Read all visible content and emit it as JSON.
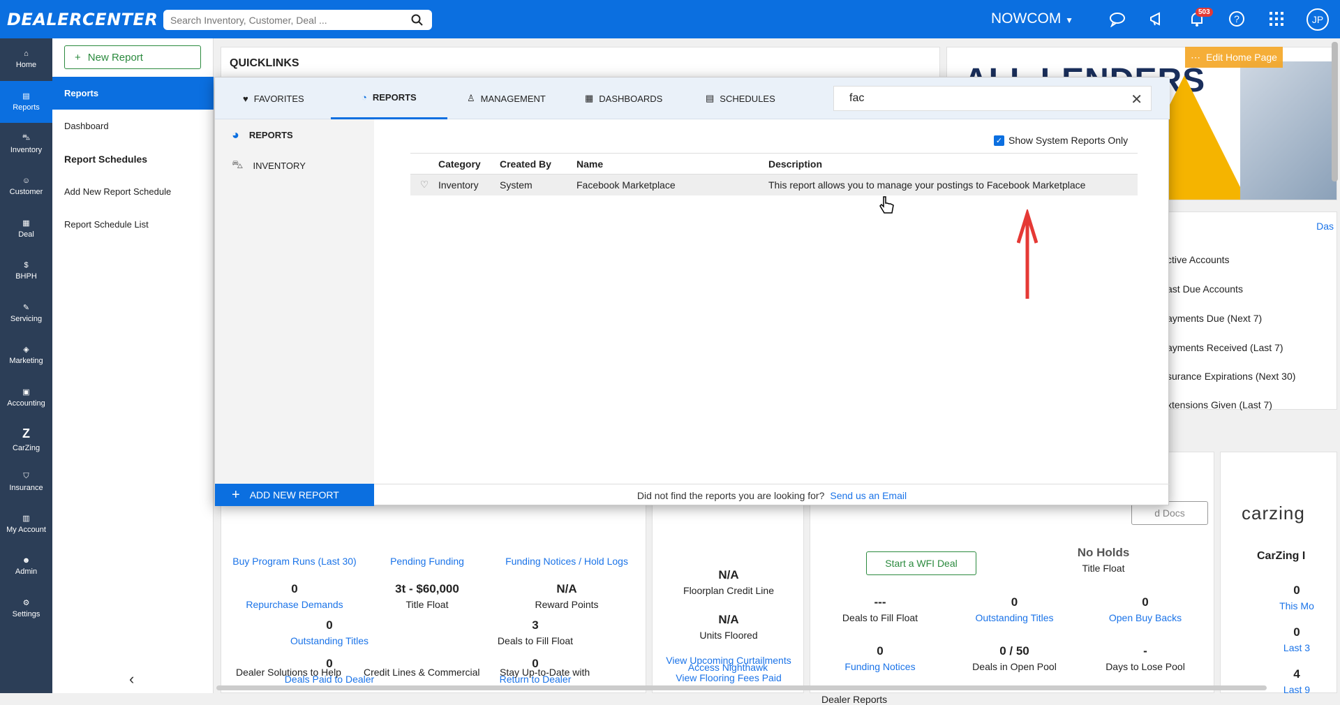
{
  "topbar": {
    "logo": "DEALERCENTER",
    "search_placeholder": "Search Inventory, Customer, Deal ...",
    "company": "NOWCOM",
    "notification_count": "503",
    "avatar": "JP"
  },
  "nav": [
    {
      "label": "Home"
    },
    {
      "label": "Reports"
    },
    {
      "label": "Inventory"
    },
    {
      "label": "Customer"
    },
    {
      "label": "Deal"
    },
    {
      "label": "BHPH"
    },
    {
      "label": "Servicing"
    },
    {
      "label": "Marketing"
    },
    {
      "label": "Accounting"
    },
    {
      "label": "CarZing"
    },
    {
      "label": "Insurance"
    },
    {
      "label": "My Account"
    },
    {
      "label": "Admin"
    },
    {
      "label": "Settings"
    }
  ],
  "subnav": {
    "new_report": "New Report",
    "reports": "Reports",
    "dashboard": "Dashboard",
    "schedules_head": "Report Schedules",
    "add_schedule": "Add New Report Schedule",
    "schedule_list": "Report Schedule List"
  },
  "main": {
    "quicklinks": "QUICKLINKS",
    "edit_home": "Edit Home Page",
    "banner_text": "ALL LENDERS",
    "right_link": "Das",
    "bhph": [
      "ctive Accounts",
      "ast Due Accounts",
      "ayments Due (Next 7)",
      "ayments Received (Last 7)",
      "surance Expirations (Next 30)",
      "xtensions Given (Last 7)"
    ],
    "col1": {
      "row0": [
        "Buy Program Runs (Last 30)",
        "Pending Funding",
        "Funding Notices / Hold Logs"
      ],
      "row1": [
        {
          "v": "0",
          "l": "Repurchase Demands"
        },
        {
          "v": "3t - $60,000",
          "l": "Title Float"
        },
        {
          "v": "N/A",
          "l": "Reward Points"
        }
      ],
      "row2": [
        {
          "v": "0",
          "l": "Outstanding Titles"
        },
        {
          "v": "3",
          "l": "Deals to Fill Float"
        }
      ],
      "row3": [
        {
          "v": "0",
          "l": "Deals Paid to Dealer"
        },
        {
          "v": "0",
          "l": "Return to Dealer"
        }
      ],
      "footer": [
        "Dealer Solutions to Help",
        "Credit Lines & Commercial",
        "Stay Up-to-Date with"
      ]
    },
    "col2": {
      "a": {
        "v": "N/A",
        "l": "Floorplan Credit Line"
      },
      "b": {
        "v": "N/A",
        "l": "Units Floored"
      },
      "links": [
        "View Upcoming Curtailments",
        "View Flooring Fees Paid",
        "Access Nighthawk"
      ]
    },
    "col3": {
      "docs": "d Docs",
      "wfi": "Start a WFI Deal",
      "noholds": "No Holds",
      "title_float": "Title Float",
      "r1": [
        {
          "v": "---",
          "l": "Deals to Fill Float"
        },
        {
          "v": "0",
          "l": "Outstanding Titles"
        },
        {
          "v": "0",
          "l": "Open Buy Backs"
        }
      ],
      "r2": [
        {
          "v": "0",
          "l": "Funding Notices"
        },
        {
          "v": "0 / 50",
          "l": "Deals in Open Pool"
        },
        {
          "v": "-",
          "l": "Days to Lose Pool"
        }
      ],
      "dealer_reports": "Dealer Reports"
    },
    "col4": {
      "logo": "carzing",
      "title": "CarZing I",
      "r": [
        {
          "v": "0",
          "l": "This Mo"
        },
        {
          "v": "0",
          "l": "Last 3"
        },
        {
          "v": "4",
          "l": "Last 9"
        }
      ]
    }
  },
  "overlay": {
    "tabs": [
      "FAVORITES",
      "REPORTS",
      "MANAGEMENT",
      "DASHBOARDS",
      "SCHEDULES"
    ],
    "search_value": "fac",
    "categories": [
      "REPORTS",
      "INVENTORY"
    ],
    "system_only": "Show System Reports Only",
    "columns": [
      "Category",
      "Created By",
      "Name",
      "Description"
    ],
    "rows": [
      {
        "category": "Inventory",
        "created_by": "System",
        "name": "Facebook Marketplace",
        "description": "This report allows you to manage your postings to Facebook Marketplace"
      }
    ],
    "add_new": "ADD NEW REPORT",
    "footer_text": "Did not find the reports you are looking for?",
    "footer_link": "Send us an Email"
  },
  "colors": {
    "primary": "#0b6fe0",
    "nav_bg": "#2c3e57",
    "arrow": "#e53935"
  }
}
